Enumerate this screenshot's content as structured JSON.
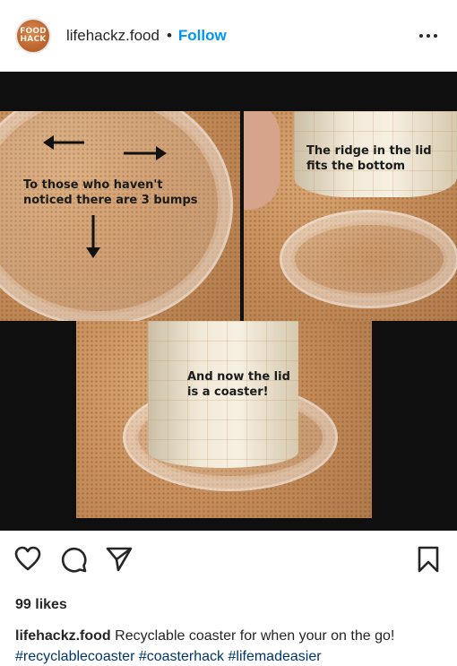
{
  "post": {
    "avatar_text_line1": "FOOD",
    "avatar_text_line2": "HACK",
    "username": "lifehackz.food",
    "separator": "•",
    "follow_label": "Follow"
  },
  "media": {
    "panel1_caption_line1": "To those who haven't",
    "panel1_caption_line2": "noticed there are 3 bumps",
    "panel2_caption_line1": "The ridge in the lid",
    "panel2_caption_line2": "fits the bottom",
    "panel3_caption_line1": "And now the lid",
    "panel3_caption_line2": "is a coaster!"
  },
  "actions": {
    "like_icon": "heart-icon",
    "comment_icon": "comment-icon",
    "share_icon": "paper-plane-icon",
    "save_icon": "bookmark-icon"
  },
  "likes_text": "99 likes",
  "caption": {
    "username": "lifehackz.food",
    "text": "Recyclable coaster for when your on the go!",
    "hashtags": [
      "#recyclablecoaster",
      "#coasterhack",
      "#lifemadeasier"
    ]
  },
  "colors": {
    "accent": "#0095f6",
    "hashtag": "#00376b",
    "text": "#262626"
  }
}
